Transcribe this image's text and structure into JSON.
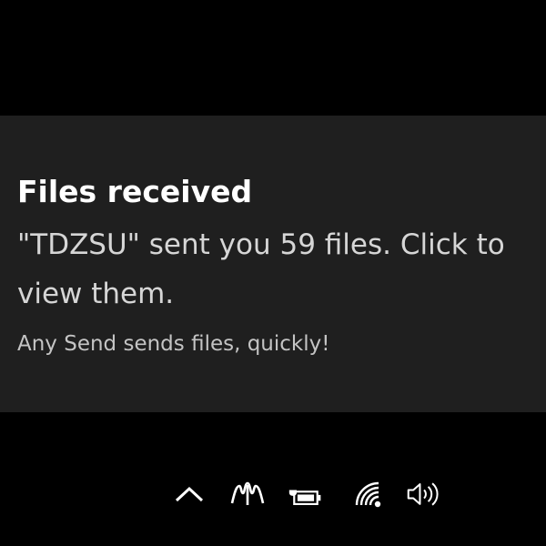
{
  "notification": {
    "title": "Files received",
    "body_line_1": "\"TDZSU\" sent you 59 files. Click to",
    "body_line_2": "view them.",
    "attribution": "Any Send sends files, quickly!"
  },
  "system_tray": {
    "icons": [
      "chevron-up-icon",
      "app-tray-icon",
      "battery-icon",
      "wifi-icon",
      "volume-icon"
    ]
  },
  "colors": {
    "screen_background": "#000000",
    "toast_background": "#1f1f1f",
    "title_text": "#ffffff",
    "body_text": "#d6d6d6"
  }
}
